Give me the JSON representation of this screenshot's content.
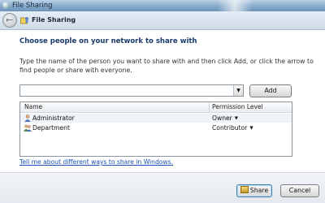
{
  "window": {
    "title": "File Sharing"
  },
  "nav": {
    "title": "File Sharing"
  },
  "heading": "Choose people on your network to share with",
  "instructions": "Type the name of the person you want to share with and then click Add, or click the arrow to find people or share with everyone.",
  "name_input": {
    "value": "",
    "placeholder": ""
  },
  "add_button": "Add",
  "table": {
    "headers": [
      "Name",
      "Permission Level"
    ],
    "rows": [
      {
        "name": "Administrator",
        "permission": "Owner",
        "icon": "user-icon"
      },
      {
        "name": "Department",
        "permission": "Contributor",
        "icon": "group-icon"
      }
    ]
  },
  "help_link": "Tell me about different ways to share in Windows.",
  "share_button": "Share",
  "cancel_button": "Cancel",
  "colors": {
    "link": "#1c4fb5",
    "heading": "#1a3a6a",
    "selection": "#eef3f8"
  }
}
